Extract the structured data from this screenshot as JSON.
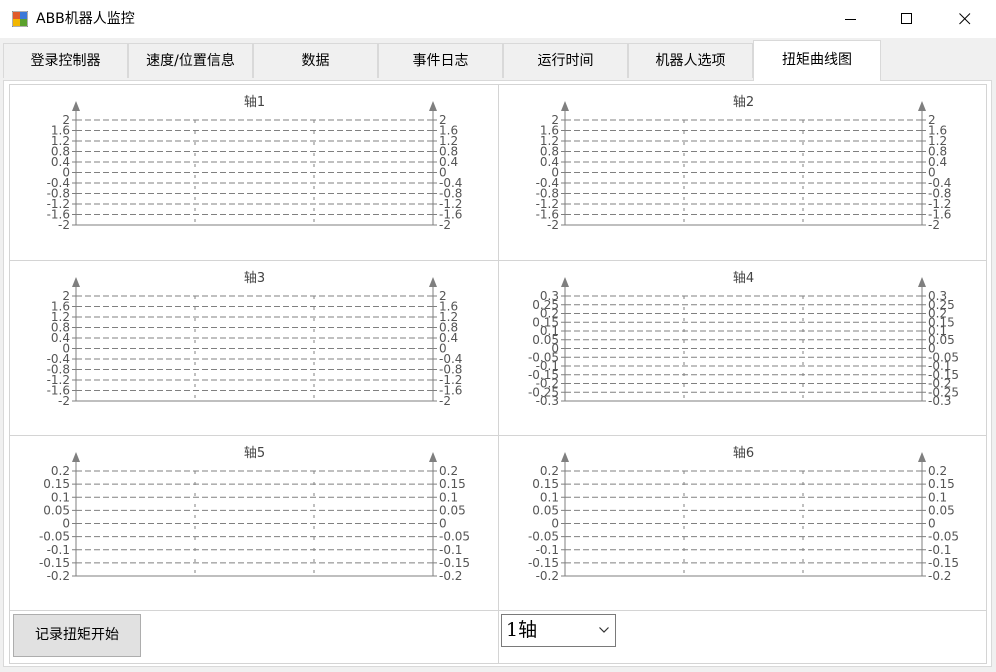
{
  "window": {
    "title": "ABB机器人监控"
  },
  "tabs": [
    {
      "label": "登录控制器"
    },
    {
      "label": "速度/位置信息"
    },
    {
      "label": "数据"
    },
    {
      "label": "事件日志"
    },
    {
      "label": "运行时间"
    },
    {
      "label": "机器人选项"
    },
    {
      "label": "扭矩曲线图"
    }
  ],
  "active_tab": "扭矩曲线图",
  "axis_panels": [
    {
      "title": "轴1",
      "ticks": [
        "2",
        "1.6",
        "1.2",
        "0.8",
        "0.4",
        "0",
        "-0.4",
        "-0.8",
        "-1.2",
        "-1.6",
        "-2"
      ]
    },
    {
      "title": "轴2",
      "ticks": [
        "2",
        "1.6",
        "1.2",
        "0.8",
        "0.4",
        "0",
        "-0.4",
        "-0.8",
        "-1.2",
        "-1.6",
        "-2"
      ]
    },
    {
      "title": "轴3",
      "ticks": [
        "2",
        "1.6",
        "1.2",
        "0.8",
        "0.4",
        "0",
        "-0.4",
        "-0.8",
        "-1.2",
        "-1.6",
        "-2"
      ]
    },
    {
      "title": "轴4",
      "ticks": [
        "0.3",
        "0.25",
        "0.2",
        "0.15",
        "0.1",
        "0.05",
        "0",
        "-0.05",
        "-0.1",
        "-0.15",
        "-0.2",
        "-0.25",
        "-0.3"
      ]
    },
    {
      "title": "轴5",
      "ticks": [
        "0.2",
        "0.15",
        "0.1",
        "0.05",
        "0",
        "-0.05",
        "-0.1",
        "-0.15",
        "-0.2"
      ]
    },
    {
      "title": "轴6",
      "ticks": [
        "0.2",
        "0.15",
        "0.1",
        "0.05",
        "0",
        "-0.05",
        "-0.1",
        "-0.15",
        "-0.2"
      ]
    }
  ],
  "controls": {
    "record_button": "记录扭矩开始",
    "axis_select": {
      "value": "1轴"
    }
  },
  "colors": {
    "axis": "#7f7f7f",
    "grid": "#808080",
    "tab_border": "#d9d9d9",
    "button_bg": "#e1e1e1"
  }
}
